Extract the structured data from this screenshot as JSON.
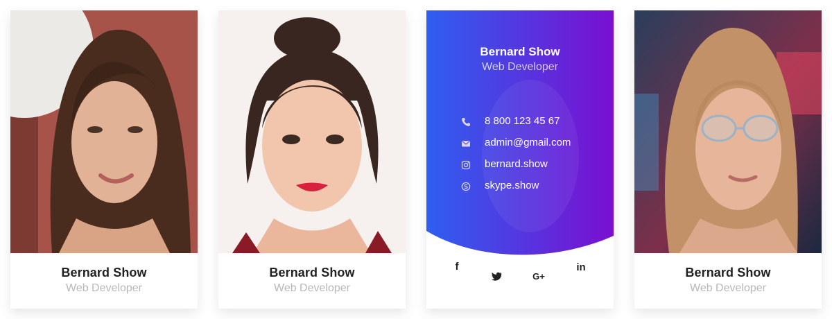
{
  "cards": [
    {
      "name": "Bernard Show",
      "role": "Web Developer"
    },
    {
      "name": "Bernard Show",
      "role": "Web Developer"
    },
    {
      "name": "Bernard Show",
      "role": "Web Developer",
      "contacts": {
        "phone": "8 800 123 45 67",
        "email": "admin@gmail.com",
        "instagram": "bernard.show",
        "skype": "skype.show"
      },
      "social": {
        "facebook": "f",
        "twitter": "twitter-icon",
        "google_plus": "G+",
        "linkedin": "in"
      },
      "gradient": {
        "from": "#2e5ff0",
        "to": "#7a0fd0"
      }
    },
    {
      "name": "Bernard Show",
      "role": "Web Developer"
    }
  ],
  "icons": [
    "phone-icon",
    "email-icon",
    "instagram-icon",
    "skype-icon",
    "facebook-icon",
    "twitter-icon",
    "google-plus-icon",
    "linkedin-icon"
  ]
}
